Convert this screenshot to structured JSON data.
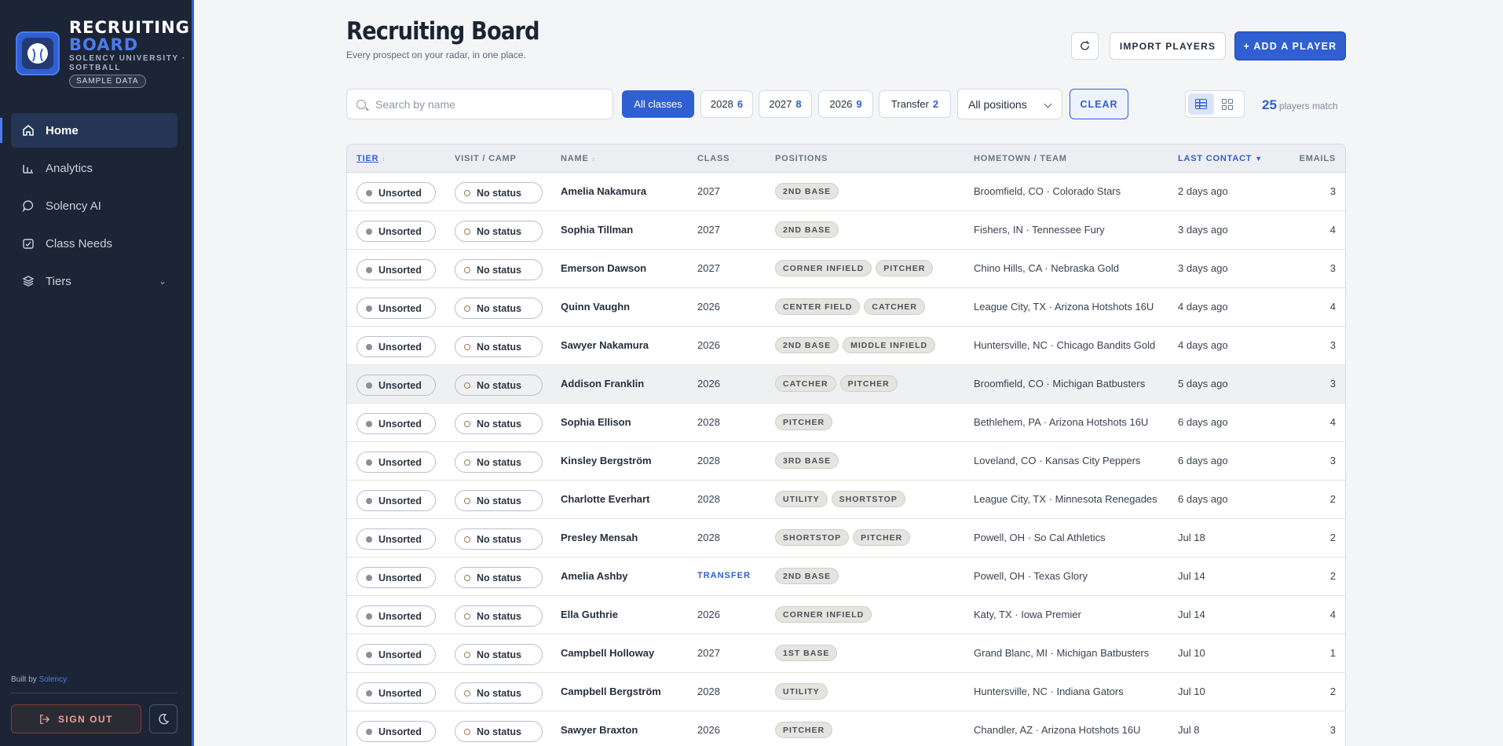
{
  "sidebar": {
    "title1": "RECRUITING",
    "title2": "BOARD",
    "subtitle": "SOLENCY UNIVERSITY · SOFTBALL",
    "badge": "SAMPLE DATA",
    "nav": [
      {
        "label": "Home",
        "icon": "home-icon"
      },
      {
        "label": "Analytics",
        "icon": "chart-icon"
      },
      {
        "label": "Solency AI",
        "icon": "chat-icon"
      },
      {
        "label": "Class Needs",
        "icon": "clipboard-icon"
      },
      {
        "label": "Tiers",
        "icon": "layers-icon"
      }
    ],
    "built_prefix": "Built by",
    "built_link": "Solency",
    "signout": "SIGN OUT"
  },
  "header": {
    "title": "Recruiting Board",
    "subtitle": "Every prospect on your radar, in one place.",
    "import": "IMPORT PLAYERS",
    "add": "+ ADD A PLAYER"
  },
  "filters": {
    "search_placeholder": "Search by name",
    "chips": [
      {
        "label": "All classes",
        "count": ""
      },
      {
        "label": "2028",
        "count": "6"
      },
      {
        "label": "2027",
        "count": "8"
      },
      {
        "label": "2026",
        "count": "9"
      },
      {
        "label": "Transfer",
        "count": "2"
      }
    ],
    "position": "All positions",
    "clear": "CLEAR",
    "match_count": "25",
    "match_label": "players match"
  },
  "table": {
    "headers": {
      "tier": "TIER",
      "visit": "VISIT / CAMP",
      "name": "NAME",
      "class": "CLASS",
      "positions": "POSITIONS",
      "hometown": "HOMETOWN / TEAM",
      "last": "LAST CONTACT",
      "emails": "EMAILS"
    },
    "sort_glyph": "↕",
    "sort_desc": "▼",
    "rows": [
      {
        "tier": "Unsorted",
        "visit": "No status",
        "name": "Amelia Nakamura",
        "class": "2027",
        "positions": [
          "2ND BASE"
        ],
        "hometown": "Broomfield, CO · Colorado Stars",
        "last": "2 days ago",
        "emails": "3"
      },
      {
        "tier": "Unsorted",
        "visit": "No status",
        "name": "Sophia Tillman",
        "class": "2027",
        "positions": [
          "2ND BASE"
        ],
        "hometown": "Fishers, IN · Tennessee Fury",
        "last": "3 days ago",
        "emails": "4"
      },
      {
        "tier": "Unsorted",
        "visit": "No status",
        "name": "Emerson Dawson",
        "class": "2027",
        "positions": [
          "CORNER INFIELD",
          "PITCHER"
        ],
        "hometown": "Chino Hills, CA · Nebraska Gold",
        "last": "3 days ago",
        "emails": "3"
      },
      {
        "tier": "Unsorted",
        "visit": "No status",
        "name": "Quinn Vaughn",
        "class": "2026",
        "positions": [
          "CENTER FIELD",
          "CATCHER"
        ],
        "hometown": "League City, TX · Arizona Hotshots 16U",
        "last": "4 days ago",
        "emails": "4"
      },
      {
        "tier": "Unsorted",
        "visit": "No status",
        "name": "Sawyer Nakamura",
        "class": "2026",
        "positions": [
          "2ND BASE",
          "MIDDLE INFIELD"
        ],
        "hometown": "Huntersville, NC · Chicago Bandits Gold",
        "last": "4 days ago",
        "emails": "3"
      },
      {
        "tier": "Unsorted",
        "visit": "No status",
        "name": "Addison Franklin",
        "class": "2026",
        "positions": [
          "CATCHER",
          "PITCHER"
        ],
        "hometown": "Broomfield, CO · Michigan Batbusters",
        "last": "5 days ago",
        "emails": "3"
      },
      {
        "tier": "Unsorted",
        "visit": "No status",
        "name": "Sophia Ellison",
        "class": "2028",
        "positions": [
          "PITCHER"
        ],
        "hometown": "Bethlehem, PA · Arizona Hotshots 16U",
        "last": "6 days ago",
        "emails": "4"
      },
      {
        "tier": "Unsorted",
        "visit": "No status",
        "name": "Kinsley Bergström",
        "class": "2028",
        "positions": [
          "3RD BASE"
        ],
        "hometown": "Loveland, CO · Kansas City Peppers",
        "last": "6 days ago",
        "emails": "3"
      },
      {
        "tier": "Unsorted",
        "visit": "No status",
        "name": "Charlotte Everhart",
        "class": "2028",
        "positions": [
          "UTILITY",
          "SHORTSTOP"
        ],
        "hometown": "League City, TX · Minnesota Renegades",
        "last": "6 days ago",
        "emails": "2"
      },
      {
        "tier": "Unsorted",
        "visit": "No status",
        "name": "Presley Mensah",
        "class": "2028",
        "positions": [
          "SHORTSTOP",
          "PITCHER"
        ],
        "hometown": "Powell, OH · So Cal Athletics",
        "last": "Jul 18",
        "emails": "2"
      },
      {
        "tier": "Unsorted",
        "visit": "No status",
        "name": "Amelia Ashby",
        "class": "TRANSFER",
        "positions": [
          "2ND BASE"
        ],
        "hometown": "Powell, OH · Texas Glory",
        "last": "Jul 14",
        "emails": "2"
      },
      {
        "tier": "Unsorted",
        "visit": "No status",
        "name": "Ella Guthrie",
        "class": "2026",
        "positions": [
          "CORNER INFIELD"
        ],
        "hometown": "Katy, TX · Iowa Premier",
        "last": "Jul 14",
        "emails": "4"
      },
      {
        "tier": "Unsorted",
        "visit": "No status",
        "name": "Campbell Holloway",
        "class": "2027",
        "positions": [
          "1ST BASE"
        ],
        "hometown": "Grand Blanc, MI · Michigan Batbusters",
        "last": "Jul 10",
        "emails": "1"
      },
      {
        "tier": "Unsorted",
        "visit": "No status",
        "name": "Campbell Bergström",
        "class": "2028",
        "positions": [
          "UTILITY"
        ],
        "hometown": "Huntersville, NC · Indiana Gators",
        "last": "Jul 10",
        "emails": "2"
      },
      {
        "tier": "Unsorted",
        "visit": "No status",
        "name": "Sawyer Braxton",
        "class": "2026",
        "positions": [
          "PITCHER"
        ],
        "hometown": "Chandler, AZ · Arizona Hotshots 16U",
        "last": "Jul 8",
        "emails": "3"
      }
    ]
  },
  "colors": {
    "accent": "#2f5fd1",
    "sidebar": "#1c2535"
  }
}
